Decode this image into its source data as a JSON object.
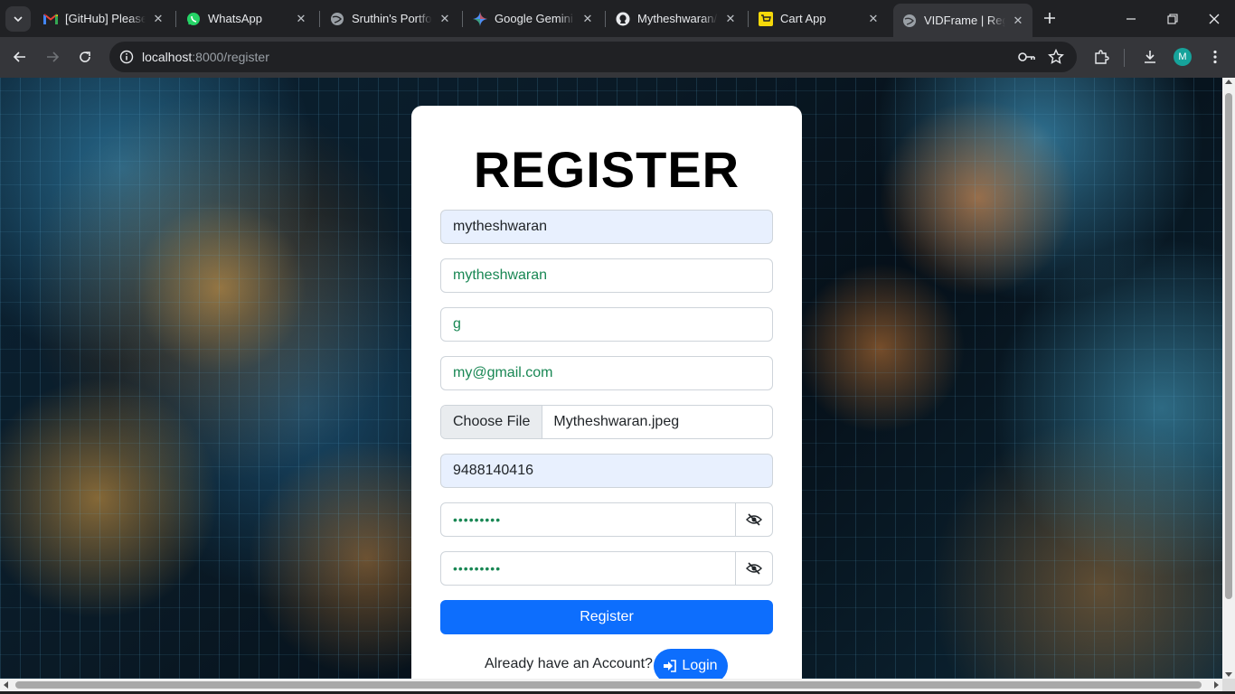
{
  "browser": {
    "tabs": [
      {
        "title": "[GitHub] Please c",
        "icon": "gmail-icon",
        "active": false
      },
      {
        "title": "WhatsApp",
        "icon": "whatsapp-icon",
        "active": false
      },
      {
        "title": "Sruthin's Portfoli",
        "icon": "globe-icon",
        "active": false
      },
      {
        "title": "Google Gemini",
        "icon": "gemini-icon",
        "active": false
      },
      {
        "title": "Mytheshwaran/I",
        "icon": "github-icon",
        "active": false
      },
      {
        "title": "Cart App",
        "icon": "cart-app-icon",
        "active": false
      },
      {
        "title": "VIDFrame | Regis",
        "icon": "globe-icon",
        "active": true
      }
    ],
    "address": {
      "host": "localhost",
      "rest": ":8000/register"
    },
    "profile_initial": "M",
    "colors": {
      "frame": "#202124",
      "toolbar": "#35363a",
      "avatar": "#16a39b"
    }
  },
  "form": {
    "title": "REGISTER",
    "username": "mytheshwaran",
    "first_name": "mytheshwaran",
    "last_name": "g",
    "email": "my@gmail.com",
    "file_button": "Choose File",
    "file_name": "Mytheshwaran.jpeg",
    "phone": "9488140416",
    "password_mask": "•••••••••",
    "confirm_password_mask": "•••••••••",
    "register_label": "Register",
    "already_text": "Already have an Account?",
    "login_label": "Login",
    "colors": {
      "primary": "#0d6efd",
      "valid": "#198754",
      "autofill": "#e8f0fe"
    }
  }
}
